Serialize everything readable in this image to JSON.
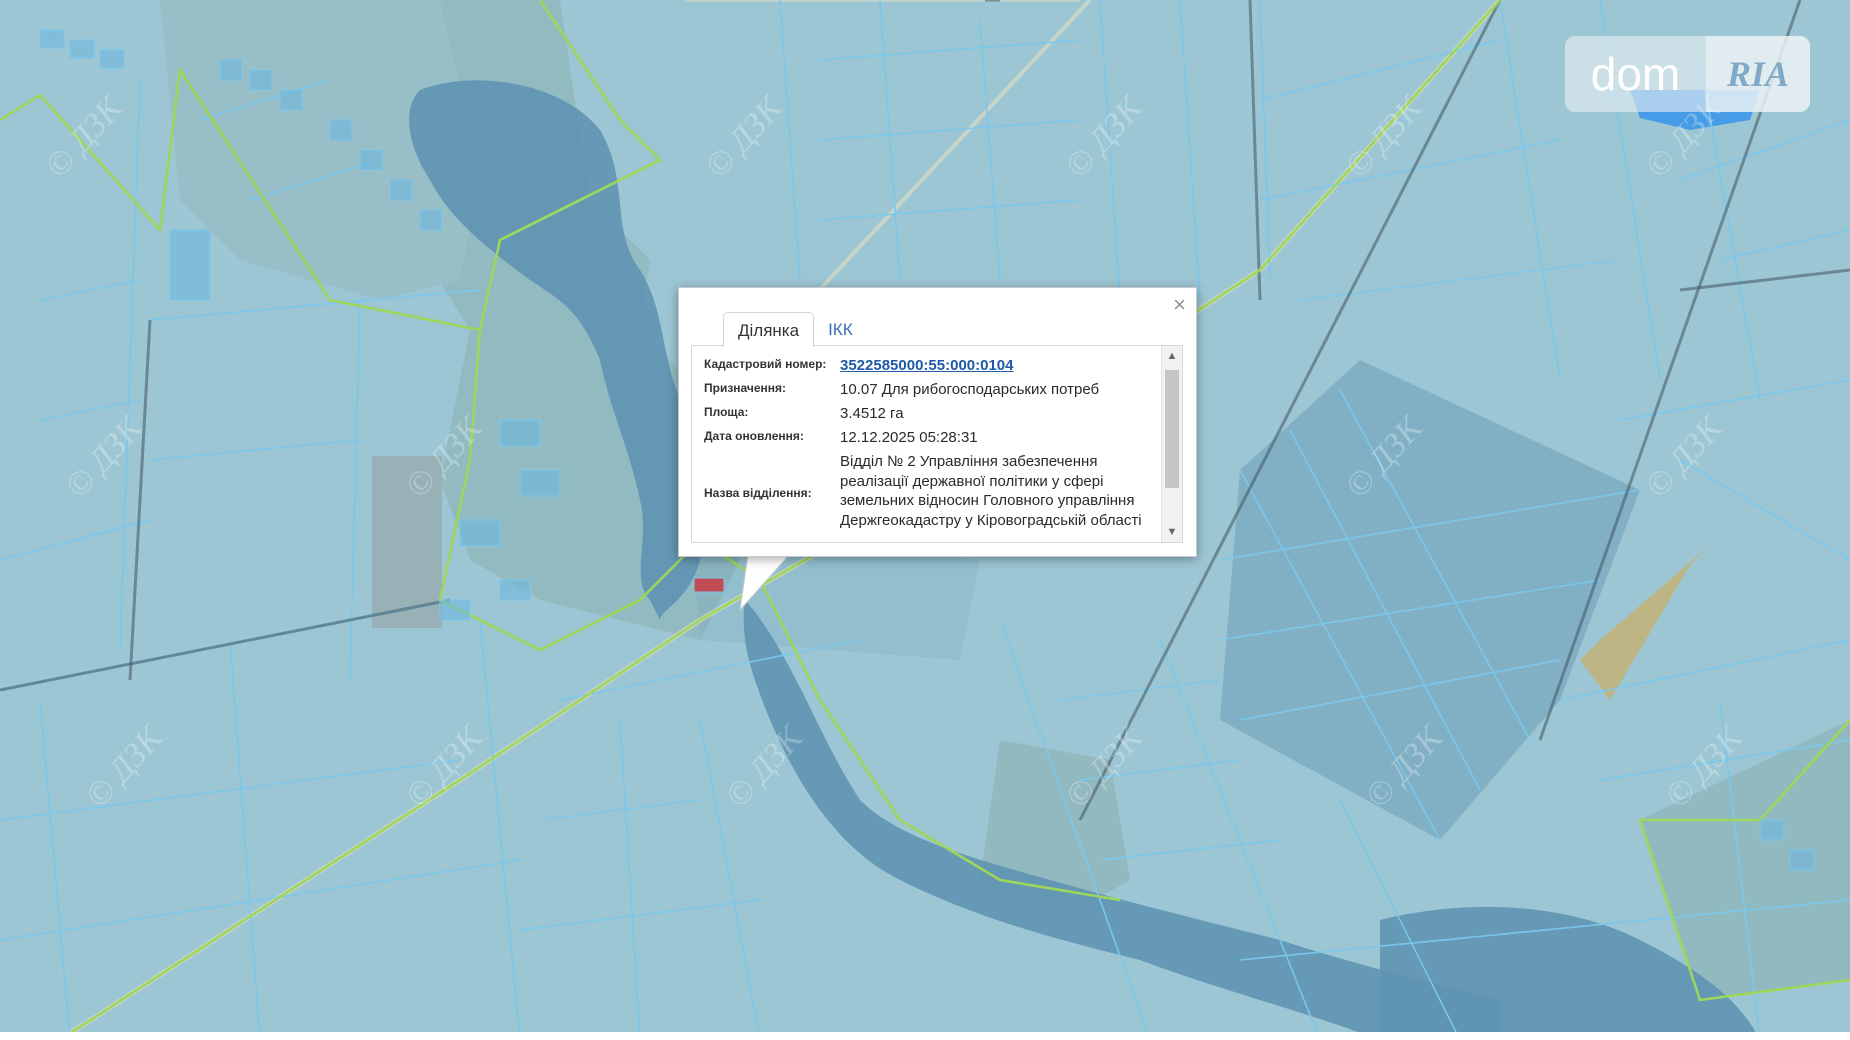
{
  "map": {
    "watermark_text": "© ДЗК"
  },
  "branding": {
    "logo_dom": "dom",
    "logo_ria": "RIA"
  },
  "popup": {
    "tabs": [
      {
        "label": "Ділянка",
        "active": true
      },
      {
        "label": "ІКК",
        "active": false
      }
    ],
    "close_symbol": "×",
    "fields": {
      "cadastral_label": "Кадастровий номер:",
      "cadastral_value": "3522585000:55:000:0104",
      "purpose_label": "Призначення:",
      "purpose_value": "10.07 Для рибогосподарських потреб",
      "area_label": "Площа:",
      "area_value": "3.4512 га",
      "updated_label": "Дата оновлення:",
      "updated_value": "12.12.2025 05:28:31",
      "department_label": "Назва відділення:",
      "department_value": "Відділ № 2 Управління забезпечення реалізації державної політики у сфері земельних відносин Головного управління Держгеокадастру у Кіровоградській області"
    },
    "scroll_up": "▲",
    "scroll_down": "▼"
  },
  "colors": {
    "water": "#5f93b3",
    "parcel_line": "#7ac8ee",
    "boundary_line": "#9ed65a",
    "link": "#1f5aa8",
    "overlay": "#8ec6e4"
  }
}
